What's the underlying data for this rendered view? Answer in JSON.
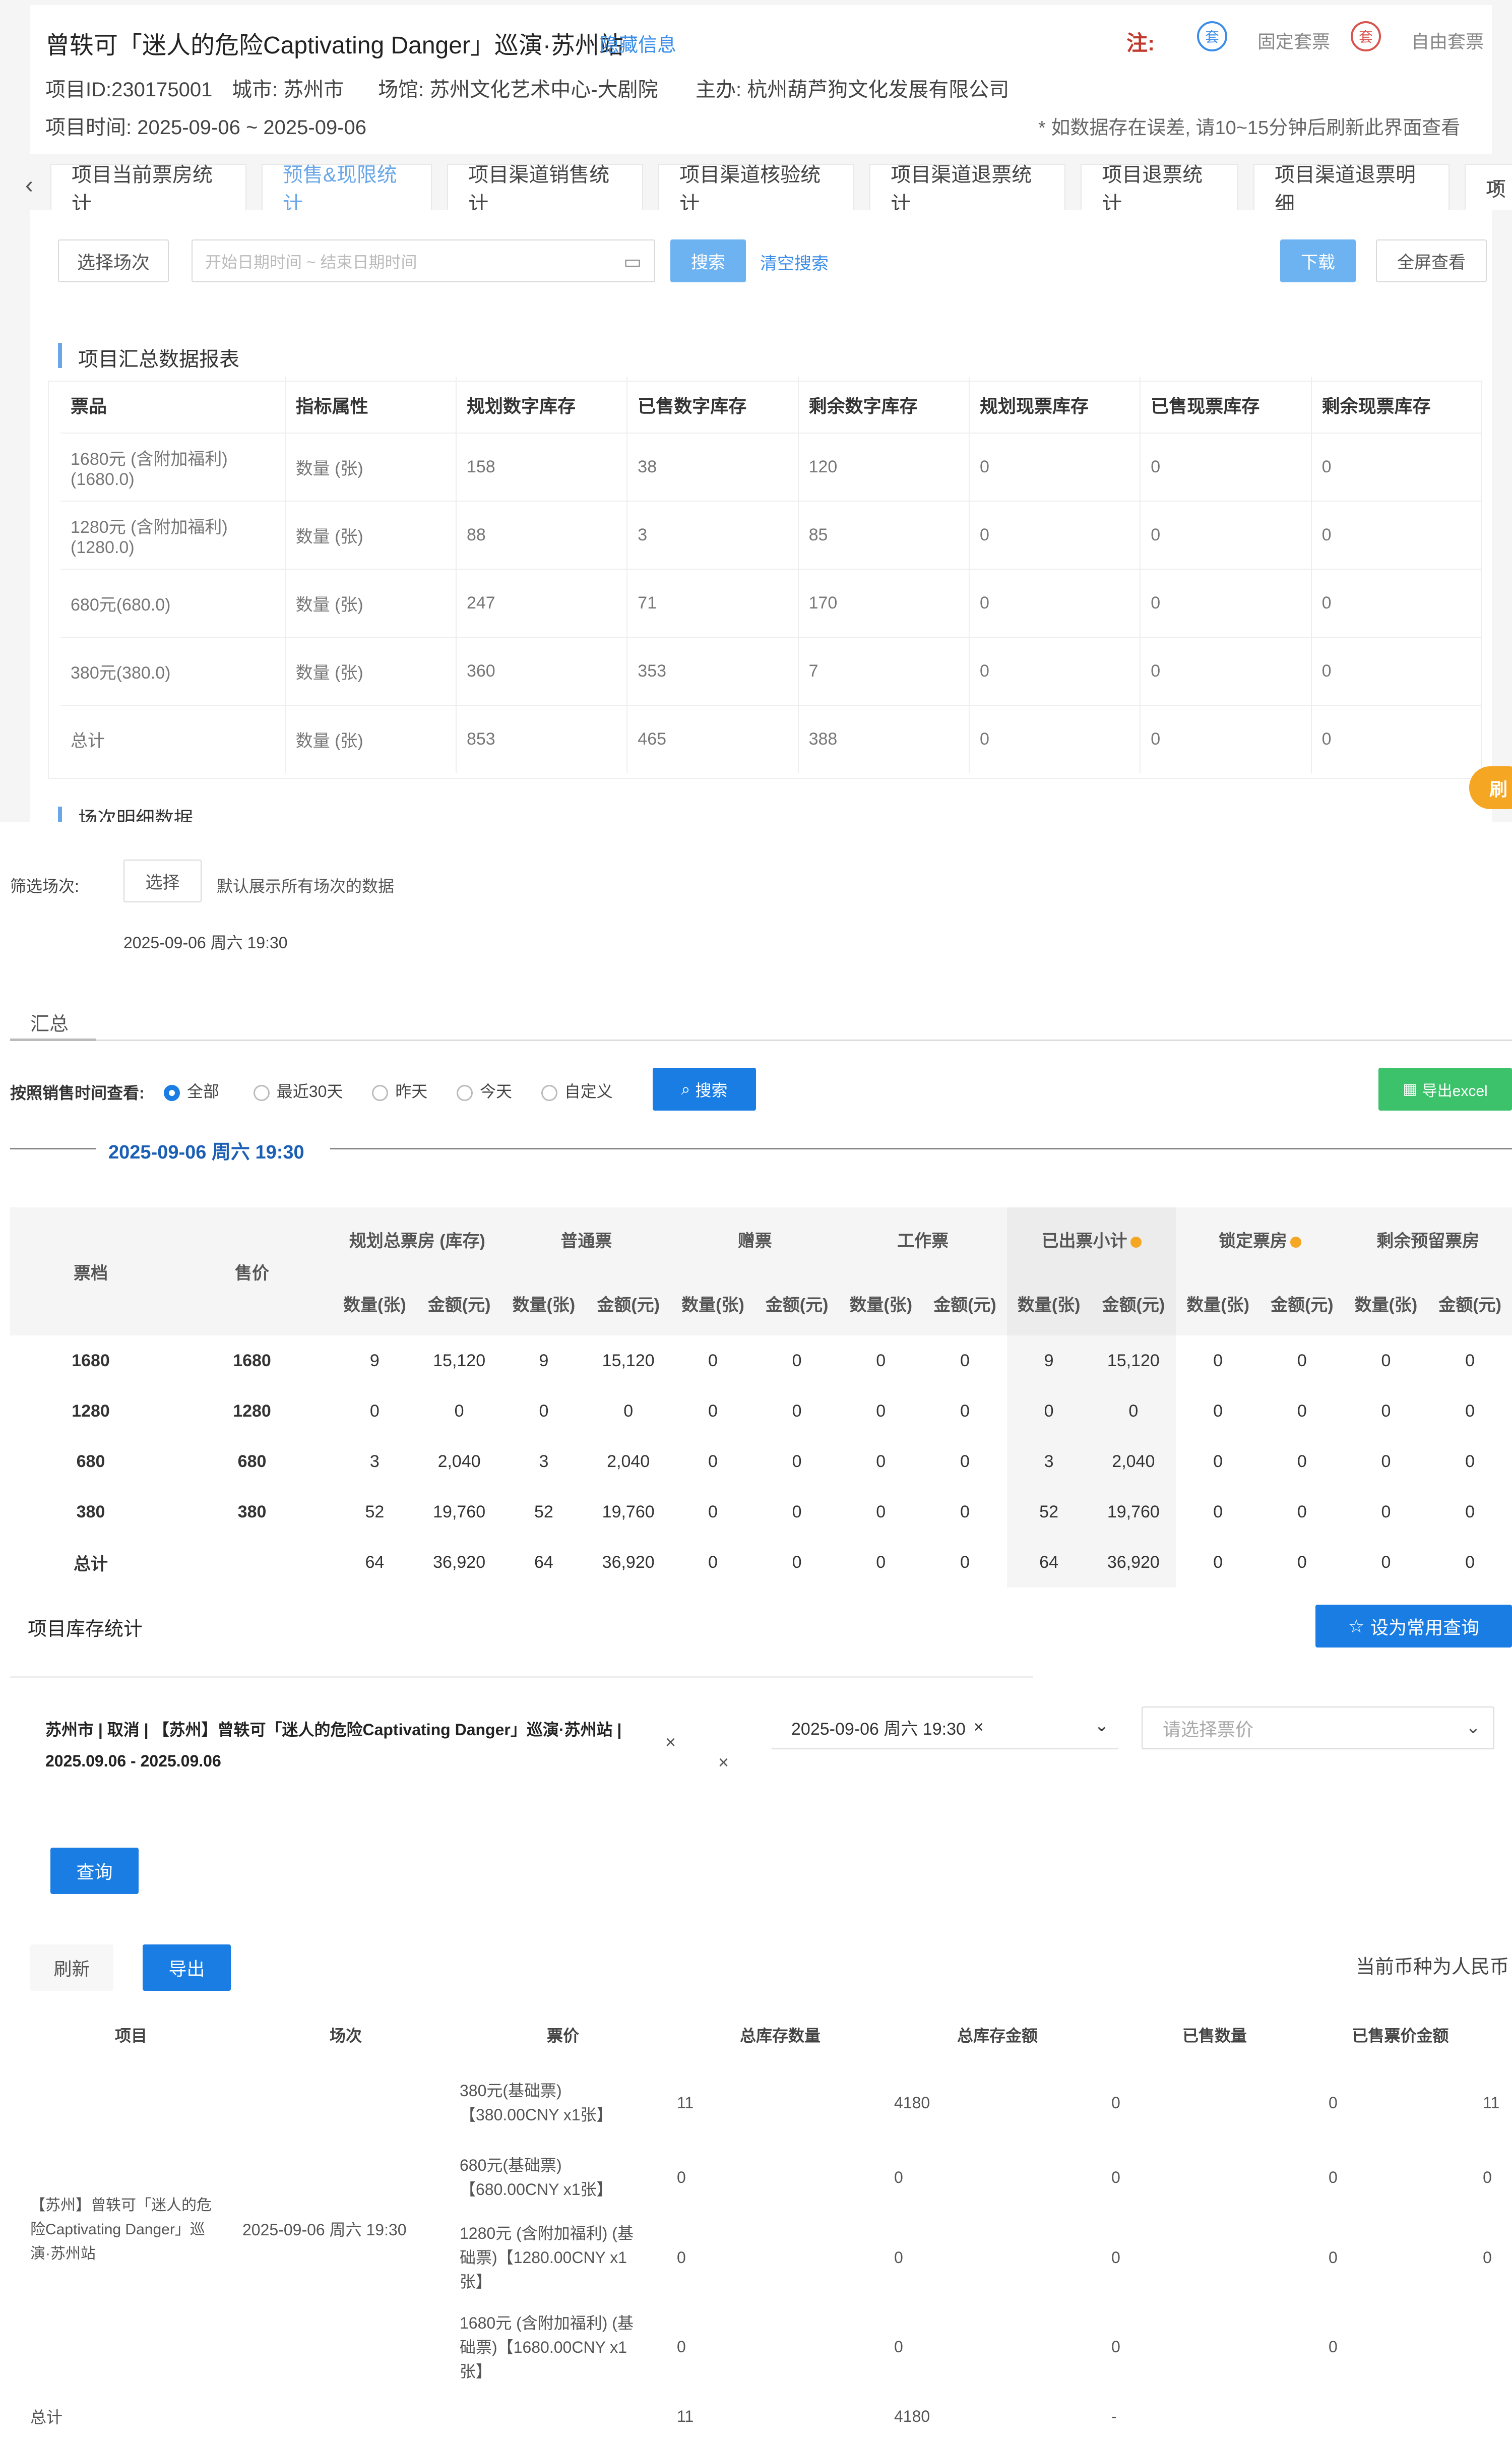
{
  "header": {
    "title": "曾轶可「迷人的危险Captivating Danger」巡演·苏州站",
    "hide_info": "隐藏信息",
    "legend_note": "注:",
    "legend_fixed_icon": "套",
    "legend_fixed": "固定套票",
    "legend_free_icon": "套",
    "legend_free": "自由套票",
    "project_id": "项目ID:230175001",
    "city": "城市: 苏州市",
    "venue": "场馆: 苏州文化艺术中心-大剧院",
    "organizer": "主办: 杭州葫芦狗文化发展有限公司",
    "project_time": "项目时间: 2025-09-06 ~ 2025-09-06",
    "refresh_note": "* 如数据存在误差, 请10~15分钟后刷新此界面查看"
  },
  "tabs": [
    "项目当前票房统计",
    "预售&现限统计",
    "项目渠道销售统计",
    "项目渠道核验统计",
    "项目渠道退票统计",
    "项目退票统计",
    "项目渠道退票明细",
    "项"
  ],
  "filter": {
    "select_session": "选择场次",
    "date_placeholder": "开始日期时间 ~ 结束日期时间",
    "search": "搜索",
    "clear": "清空搜索",
    "download": "下载",
    "fullscreen": "全屏查看"
  },
  "report1": {
    "title": "项目汇总数据报表",
    "headers": [
      "票品",
      "指标属性",
      "规划数字库存",
      "已售数字库存",
      "剩余数字库存",
      "规划现票库存",
      "已售现票库存",
      "剩余现票库存"
    ],
    "rows": [
      [
        "1680元 (含附加福利) (1680.0)",
        "数量 (张)",
        "158",
        "38",
        "120",
        "0",
        "0",
        "0"
      ],
      [
        "1280元 (含附加福利) (1280.0)",
        "数量 (张)",
        "88",
        "3",
        "85",
        "0",
        "0",
        "0"
      ],
      [
        "680元(680.0)",
        "数量 (张)",
        "247",
        "71",
        "170",
        "0",
        "0",
        "0"
      ],
      [
        "380元(380.0)",
        "数量 (张)",
        "360",
        "353",
        "7",
        "0",
        "0",
        "0"
      ],
      [
        "总计",
        "数量 (张)",
        "853",
        "465",
        "388",
        "0",
        "0",
        "0"
      ]
    ],
    "next_section": "场次明细数据",
    "float_btn": "刷"
  },
  "session": {
    "label": "筛选场次:",
    "select": "选择",
    "hint": "默认展示所有场次的数据",
    "date": "2025-09-06 周六 19:30",
    "tab": "汇总",
    "time_filter_label": "按照销售时间查看:",
    "options": [
      "全部",
      "最近30天",
      "昨天",
      "今天",
      "自定义"
    ],
    "search": "搜索",
    "export": "导出excel",
    "divider_date": "2025-09-06 周六 19:30"
  },
  "report2": {
    "col_ticket": "票档",
    "col_price": "售价",
    "groups": [
      "规划总票房 (库存)",
      "普通票",
      "赠票",
      "工作票",
      "已出票小计",
      "锁定票房",
      "剩余预留票房"
    ],
    "sub_qty": "数量(张)",
    "sub_amt": "金额(元)",
    "rows": [
      [
        "1680",
        "1680",
        "9",
        "15,120",
        "9",
        "15,120",
        "0",
        "0",
        "0",
        "0",
        "9",
        "15,120",
        "0",
        "0",
        "0",
        "0"
      ],
      [
        "1280",
        "1280",
        "0",
        "0",
        "0",
        "0",
        "0",
        "0",
        "0",
        "0",
        "0",
        "0",
        "0",
        "0",
        "0",
        "0"
      ],
      [
        "680",
        "680",
        "3",
        "2,040",
        "3",
        "2,040",
        "0",
        "0",
        "0",
        "0",
        "3",
        "2,040",
        "0",
        "0",
        "0",
        "0"
      ],
      [
        "380",
        "380",
        "52",
        "19,760",
        "52",
        "19,760",
        "0",
        "0",
        "0",
        "0",
        "52",
        "19,760",
        "0",
        "0",
        "0",
        "0"
      ],
      [
        "总计",
        "",
        "64",
        "36,920",
        "64",
        "36,920",
        "0",
        "0",
        "0",
        "0",
        "64",
        "36,920",
        "0",
        "0",
        "0",
        "0"
      ]
    ]
  },
  "inventory": {
    "title": "项目库存统计",
    "set_common": "设为常用查询",
    "project_tag": "苏州市 | 取消 | 【苏州】曾轶可「迷人的危险Captivating Danger」巡演·苏州站 | 2025.09.06 - 2025.09.06",
    "session_value": "2025-09-06 周六 19:30",
    "price_placeholder": "请选择票价",
    "query": "查询",
    "refresh": "刷新",
    "export": "导出",
    "currency_note": "当前币种为人民币",
    "headers": [
      "项目",
      "场次",
      "票价",
      "总库存数量",
      "总库存金额",
      "已售数量",
      "已售票价金额"
    ],
    "project_name": "【苏州】曾轶可「迷人的危险Captivating Danger」巡演·苏州站",
    "session_name": "2025-09-06 周六 19:30",
    "rows": [
      [
        "380元(基础票)【380.00CNY x1张】",
        "11",
        "4180",
        "0",
        "0",
        "11"
      ],
      [
        "680元(基础票)【680.00CNY x1张】",
        "0",
        "0",
        "0",
        "0",
        "0"
      ],
      [
        "1280元 (含附加福利) (基础票)【1280.00CNY x1张】",
        "0",
        "0",
        "0",
        "0",
        "0"
      ],
      [
        "1680元 (含附加福利) (基础票)【1680.00CNY x1张】",
        "0",
        "0",
        "0",
        "0",
        ""
      ]
    ],
    "total_label": "总计",
    "total_qty": "11",
    "total_amt": "4180",
    "total_sold": "-"
  }
}
